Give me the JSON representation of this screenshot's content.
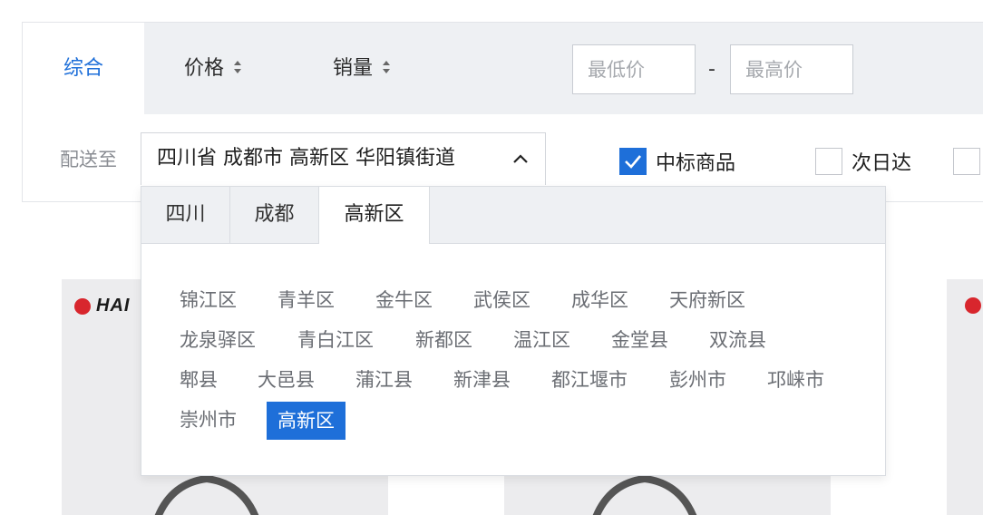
{
  "sort": {
    "tabs": [
      {
        "label": "综合",
        "active": true
      },
      {
        "label": "价格",
        "sortable": true
      },
      {
        "label": "销量",
        "sortable": true
      }
    ],
    "price_min_placeholder": "最低价",
    "price_max_placeholder": "最高价",
    "price_separator": "-"
  },
  "filter": {
    "ship_to_label": "配送至",
    "address_value": "四川省 成都市 高新区 华阳镇街道",
    "checks": [
      {
        "label": "中标商品",
        "checked": true
      },
      {
        "label": "次日达",
        "checked": false
      },
      {
        "label": "",
        "checked": false
      }
    ]
  },
  "dropdown": {
    "tabs": [
      "四川",
      "成都",
      "高新区"
    ],
    "active_tab": "高新区",
    "districts": [
      [
        "锦江区",
        "青羊区",
        "金牛区",
        "武侯区",
        "成华区",
        "天府新区"
      ],
      [
        "龙泉驿区",
        "青白江区",
        "新都区",
        "温江区",
        "金堂县",
        "双流县"
      ],
      [
        "郫县",
        "大邑县",
        "蒲江县",
        "新津县",
        "都江堰市",
        "彭州市",
        "邛崃市"
      ],
      [
        "崇州市",
        "高新区"
      ]
    ],
    "selected": "高新区"
  },
  "cards": [
    {
      "brand": "HAI"
    },
    {
      "brand": ""
    },
    {
      "brand": ""
    }
  ],
  "colors": {
    "accent": "#1e6fd9",
    "bar_bg": "#eef0f3",
    "muted_text": "#8a8d93"
  }
}
